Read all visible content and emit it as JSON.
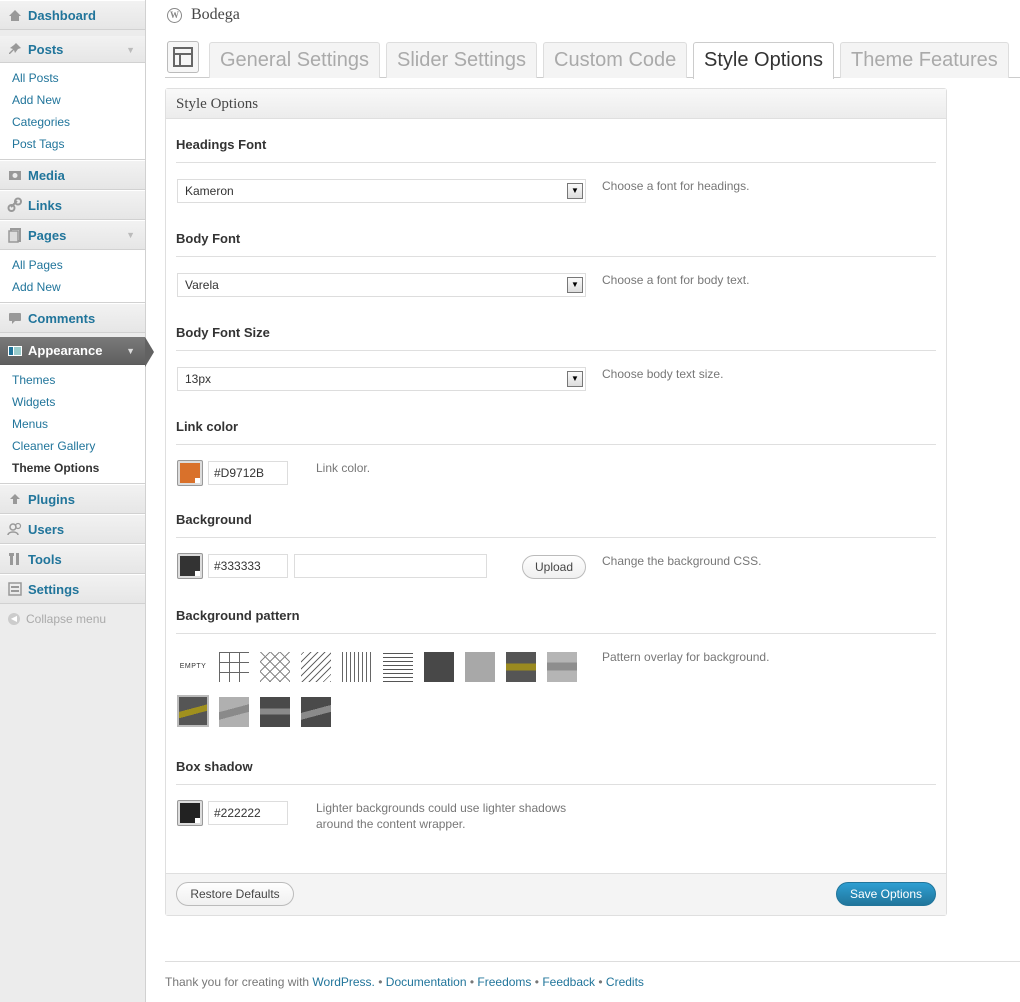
{
  "sidebar": {
    "dashboard": "Dashboard",
    "posts": "Posts",
    "posts_sub": [
      "All Posts",
      "Add New",
      "Categories",
      "Post Tags"
    ],
    "media": "Media",
    "links": "Links",
    "pages": "Pages",
    "pages_sub": [
      "All Pages",
      "Add New"
    ],
    "comments": "Comments",
    "appearance": "Appearance",
    "appearance_sub": [
      "Themes",
      "Widgets",
      "Menus",
      "Cleaner Gallery",
      "Theme Options"
    ],
    "plugins": "Plugins",
    "users": "Users",
    "tools": "Tools",
    "settings": "Settings",
    "collapse": "Collapse menu"
  },
  "site_title": "Bodega",
  "tabs": [
    "General Settings",
    "Slider Settings",
    "Custom Code",
    "Style Options",
    "Theme Features"
  ],
  "active_tab": "Style Options",
  "panel": {
    "title": "Style Options",
    "headings_font": {
      "label": "Headings Font",
      "value": "Kameron",
      "desc": "Choose a font for headings."
    },
    "body_font": {
      "label": "Body Font",
      "value": "Varela",
      "desc": "Choose a font for body text."
    },
    "body_font_size": {
      "label": "Body Font Size",
      "value": "13px",
      "desc": "Choose body text size."
    },
    "link_color": {
      "label": "Link color",
      "value": "#D9712B",
      "desc": "Link color."
    },
    "background": {
      "label": "Background",
      "value": "#333333",
      "upload": "Upload",
      "desc": "Change the background CSS."
    },
    "background_pattern": {
      "label": "Background pattern",
      "empty": "EMPTY",
      "desc": "Pattern overlay for background."
    },
    "box_shadow": {
      "label": "Box shadow",
      "value": "#222222",
      "desc_line1": "Lighter backgrounds could use lighter shadows",
      "desc_line2": "around the content wrapper."
    },
    "restore": "Restore Defaults",
    "save": "Save Options"
  },
  "footer": {
    "prefix": "Thank you for creating with",
    "wordpress": "WordPress.",
    "documentation": "Documentation",
    "freedoms": "Freedoms",
    "feedback": "Feedback",
    "credits": "Credits",
    "sep": "•"
  },
  "colors": {
    "link": "#21759b",
    "accent_orange": "#D9712B",
    "bg_dark": "#333333",
    "shadow": "#222222"
  }
}
